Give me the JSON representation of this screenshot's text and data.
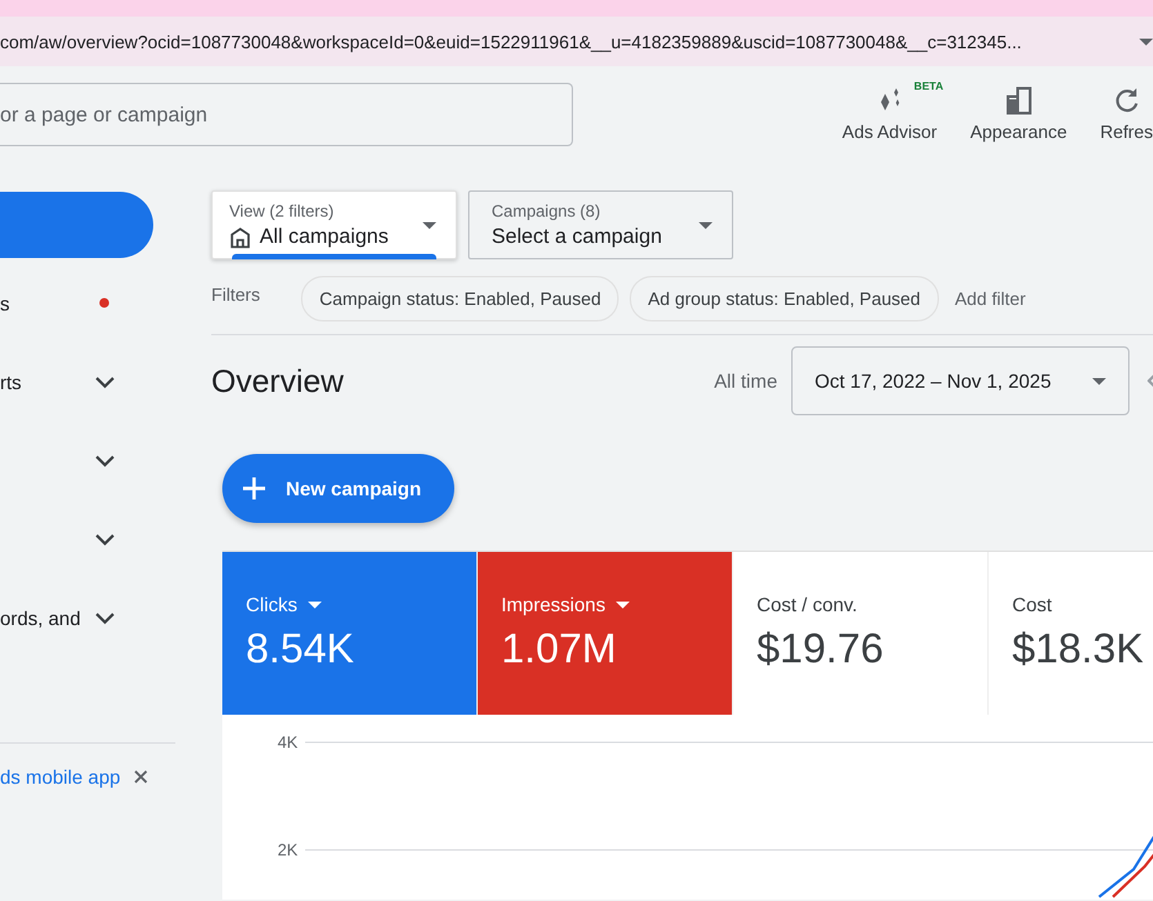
{
  "address_bar": {
    "url": "com/aw/overview?ocid=1087730048&workspaceId=0&euid=1522911961&__u=4182359889&uscid=1087730048&__c=312345..."
  },
  "header": {
    "search": {
      "placeholder": "or a page or campaign"
    },
    "actions": [
      {
        "kind": "advisor",
        "label": "Ads Advisor",
        "badge": "BETA"
      },
      {
        "kind": "appearance",
        "label": "Appearance"
      },
      {
        "kind": "refresh",
        "label": "Refres"
      }
    ]
  },
  "sidebar": {
    "items": [
      {
        "label": "s",
        "alert": true,
        "expandable": false
      },
      {
        "label": "rts",
        "alert": false,
        "expandable": true
      },
      {
        "alert": false,
        "expandable": true
      },
      {
        "alert": false,
        "expandable": true
      },
      {
        "label": "ords, and",
        "alert": false,
        "expandable": true
      }
    ],
    "promo": {
      "link": "ds mobile app"
    }
  },
  "selectors": [
    {
      "caption": "View (2 filters)",
      "value": "All campaigns",
      "kind": "view",
      "selected": true
    },
    {
      "caption": "Campaigns (8)",
      "value": "Select a campaign",
      "kind": "campaign",
      "selected": false
    }
  ],
  "filters": {
    "label": "Filters",
    "chips": [
      "Campaign status: Enabled, Paused",
      "Ad group status: Enabled, Paused"
    ],
    "add": "Add filter"
  },
  "overview": {
    "title": "Overview",
    "range_label": "All time",
    "date_range": "Oct 17, 2022 – Nov 1, 2025"
  },
  "new_campaign": {
    "label": "New campaign"
  },
  "metrics": [
    {
      "label": "Clicks",
      "value": "8.54K",
      "selected": true,
      "color": "#1a73e8"
    },
    {
      "label": "Impressions",
      "value": "1.07M",
      "selected": true,
      "color": "#d93025"
    },
    {
      "label": "Cost / conv.",
      "value": "$19.76",
      "selected": false,
      "color": "#ffffff"
    },
    {
      "label": "Cost",
      "value": "$18.3K",
      "selected": false,
      "color": "#ffffff"
    }
  ],
  "chart": {
    "y_labels": [
      "4K",
      "2K"
    ]
  }
}
